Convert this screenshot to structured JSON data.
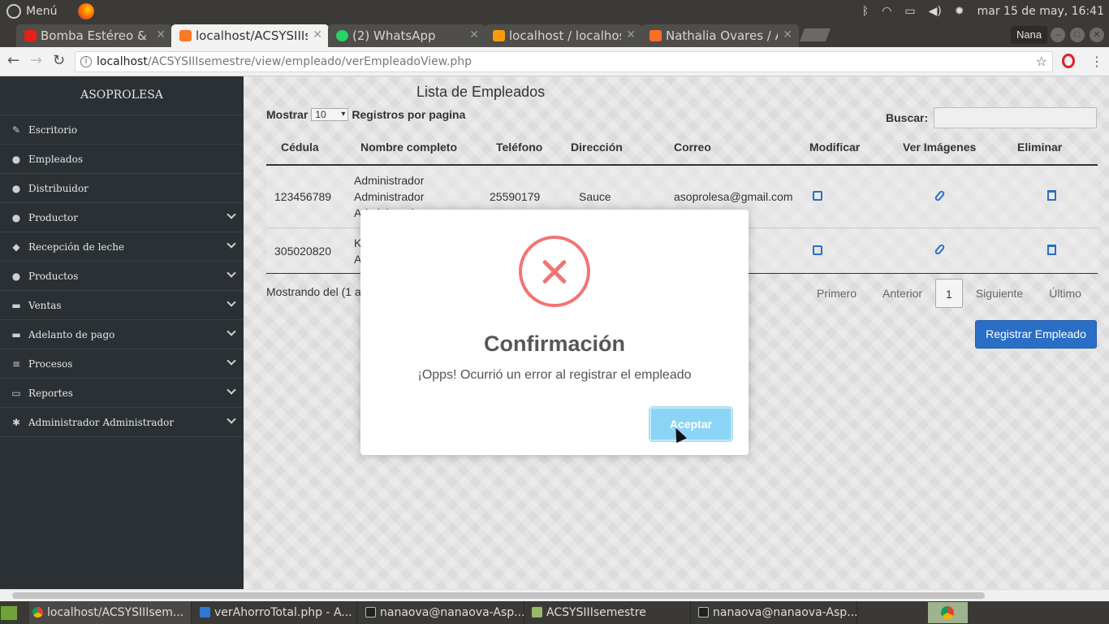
{
  "os": {
    "menu_label": "Menú",
    "clock": "mar 15 de may, 16:41",
    "user_label": "Nana"
  },
  "browser": {
    "tabs": [
      {
        "title": "Bomba Estéreo &",
        "icon": "youtube-icon",
        "color": "#e62117"
      },
      {
        "title": "localhost/ACSYSIIIs",
        "icon": "xampp-icon",
        "color": "#fb7a24"
      },
      {
        "title": "(2) WhatsApp",
        "icon": "whatsapp-icon",
        "color": "#25d366"
      },
      {
        "title": "localhost / localhos",
        "icon": "phpmyadmin-icon",
        "color": "#f89c0e"
      },
      {
        "title": "Nathalia Ovares / A",
        "icon": "gitlab-icon",
        "color": "#fc6d26"
      }
    ],
    "url_host": "localhost",
    "url_path": "/ACSYSIIIsemestre/view/empleado/verEmpleadoView.php"
  },
  "sidebar": {
    "brand": "ASOPROLESA",
    "items": [
      {
        "label": "Escritorio",
        "icon": "pin-icon",
        "glyph": "✎",
        "expandable": false
      },
      {
        "label": "Empleados",
        "icon": "users-icon",
        "glyph": "●",
        "expandable": false
      },
      {
        "label": "Distribuidor",
        "icon": "user-icon",
        "glyph": "●",
        "expandable": false
      },
      {
        "label": "Productor",
        "icon": "user-icon",
        "glyph": "●",
        "expandable": true
      },
      {
        "label": "Recepción de leche",
        "icon": "tint-icon",
        "glyph": "◆",
        "expandable": true
      },
      {
        "label": "Productos",
        "icon": "bulb-icon",
        "glyph": "●",
        "expandable": true
      },
      {
        "label": "Ventas",
        "icon": "cart-icon",
        "glyph": "▬",
        "expandable": true
      },
      {
        "label": "Adelanto de pago",
        "icon": "money-icon",
        "glyph": "▬",
        "expandable": true
      },
      {
        "label": "Procesos",
        "icon": "server-icon",
        "glyph": "≡",
        "expandable": true
      },
      {
        "label": "Reportes",
        "icon": "folder-icon",
        "glyph": "▭",
        "expandable": true
      },
      {
        "label": "Administrador Administrador",
        "icon": "gear-icon",
        "glyph": "✱",
        "expandable": true
      }
    ]
  },
  "main": {
    "title": "Lista de Empleados",
    "show_label": "Mostrar",
    "page_size": "10",
    "per_page_label": "Registros por pagina",
    "search_label": "Buscar:",
    "columns": [
      "Cédula",
      "Nombre completo",
      "Teléfono",
      "Dirección",
      "Correo",
      "Modificar",
      "Ver Imágenes",
      "Eliminar"
    ],
    "rows": [
      {
        "cedula": "123456789",
        "nombre": "Administrador\nAdministrador\nAdministrador",
        "telefono": "25590179",
        "direccion": "Sauce",
        "correo": "asoprolesa@gmail.com"
      },
      {
        "cedula": "305020820",
        "nombre": "K\nA",
        "telefono": "",
        "direccion": "",
        "correo": ""
      }
    ],
    "info_text": "Mostrando del (1 a",
    "pager": {
      "first": "Primero",
      "prev": "Anterior",
      "current": "1",
      "next": "Siguiente",
      "last": "Último"
    },
    "register_button": "Registrar Empleado"
  },
  "modal": {
    "title": "Confirmación",
    "message": "¡Opps! Ocurrió un error al registrar el empleado",
    "ok_button": "Aceptar",
    "error_color": "#f27474"
  },
  "taskbar": {
    "items": [
      {
        "label": "localhost/ACSYSIIIsem...",
        "icon": "chrome-icon"
      },
      {
        "label": "verAhorroTotal.php - A...",
        "icon": "vscode-icon"
      },
      {
        "label": "nanaova@nanaova-Asp...",
        "icon": "terminal-icon"
      },
      {
        "label": "ACSYSIIIsemestre",
        "icon": "folder-icon"
      },
      {
        "label": "nanaova@nanaova-Asp...",
        "icon": "terminal-icon"
      }
    ]
  }
}
